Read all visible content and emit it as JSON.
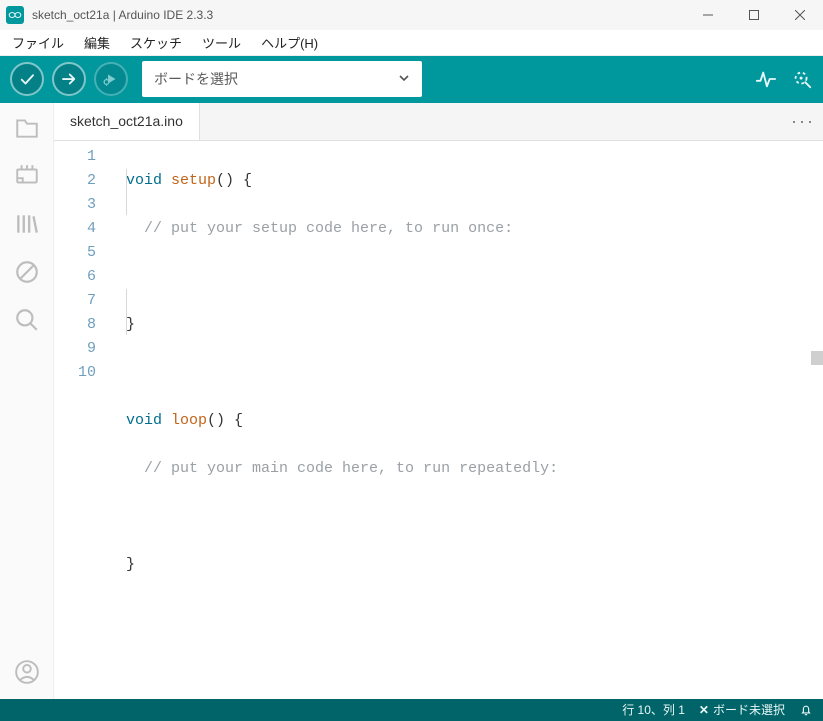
{
  "window": {
    "title": "sketch_oct21a | Arduino IDE 2.3.3"
  },
  "menu": {
    "file": "ファイル",
    "edit": "編集",
    "sketch": "スケッチ",
    "tools": "ツール",
    "help": "ヘルプ(H)"
  },
  "toolbar": {
    "board_placeholder": "ボードを選択"
  },
  "tabs": {
    "active": "sketch_oct21a.ino"
  },
  "code": {
    "lines": [
      "1",
      "2",
      "3",
      "4",
      "5",
      "6",
      "7",
      "8",
      "9",
      "10"
    ],
    "l1_kw": "void",
    "l1_fn": "setup",
    "l1_rest": "() {",
    "l2_comment": "// put your setup code here, to run once:",
    "l4_brace": "}",
    "l6_kw": "void",
    "l6_fn": "loop",
    "l6_rest": "() {",
    "l7_comment": "// put your main code here, to run repeatedly:",
    "l9_brace": "}"
  },
  "status": {
    "cursor": "行 10、列 1",
    "board": "ボード未選択"
  }
}
